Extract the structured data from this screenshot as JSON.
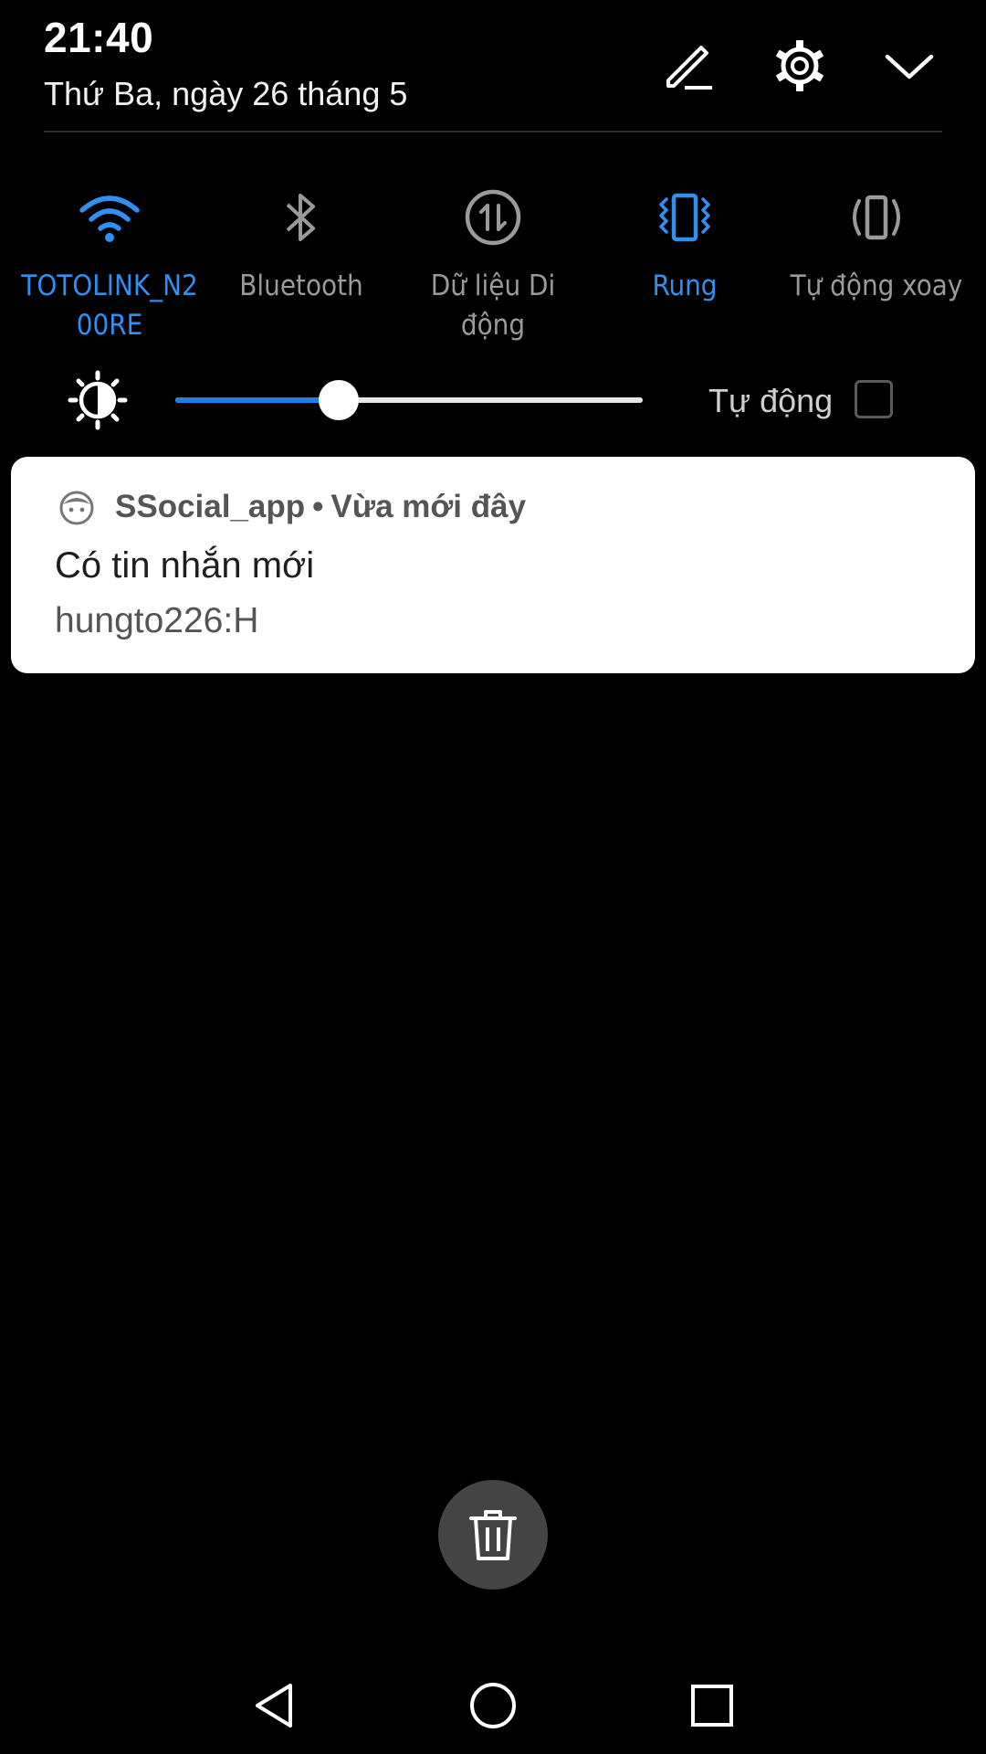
{
  "header": {
    "time": "21:40",
    "date": "Thứ Ba, ngày 26 tháng 5"
  },
  "quick_settings": {
    "toggles": [
      {
        "id": "wifi",
        "label": "TOTOLINK_N2\n00RE",
        "active": true,
        "icon": "wifi-icon"
      },
      {
        "id": "bluetooth",
        "label": "Bluetooth",
        "active": false,
        "icon": "bluetooth-icon"
      },
      {
        "id": "mobile-data",
        "label": "Dữ liệu Di\nđộng",
        "active": false,
        "icon": "mobile-data-icon"
      },
      {
        "id": "vibrate",
        "label": "Rung",
        "active": true,
        "icon": "vibrate-icon"
      },
      {
        "id": "auto-rotate",
        "label": "Tự động xoay",
        "active": false,
        "icon": "auto-rotate-icon"
      }
    ],
    "brightness": {
      "level": 0.35,
      "auto_label": "Tự động",
      "auto_checked": false
    }
  },
  "notification": {
    "app_name": "SSocial_app",
    "separator": "•",
    "time": "Vừa mới đây",
    "title": "Có tin nhắn mới",
    "body": "hungto226:H"
  },
  "colors": {
    "accent": "#2f8ff2",
    "background": "#000000",
    "inactive": "#9a9a9a",
    "card": "#ffffff"
  }
}
